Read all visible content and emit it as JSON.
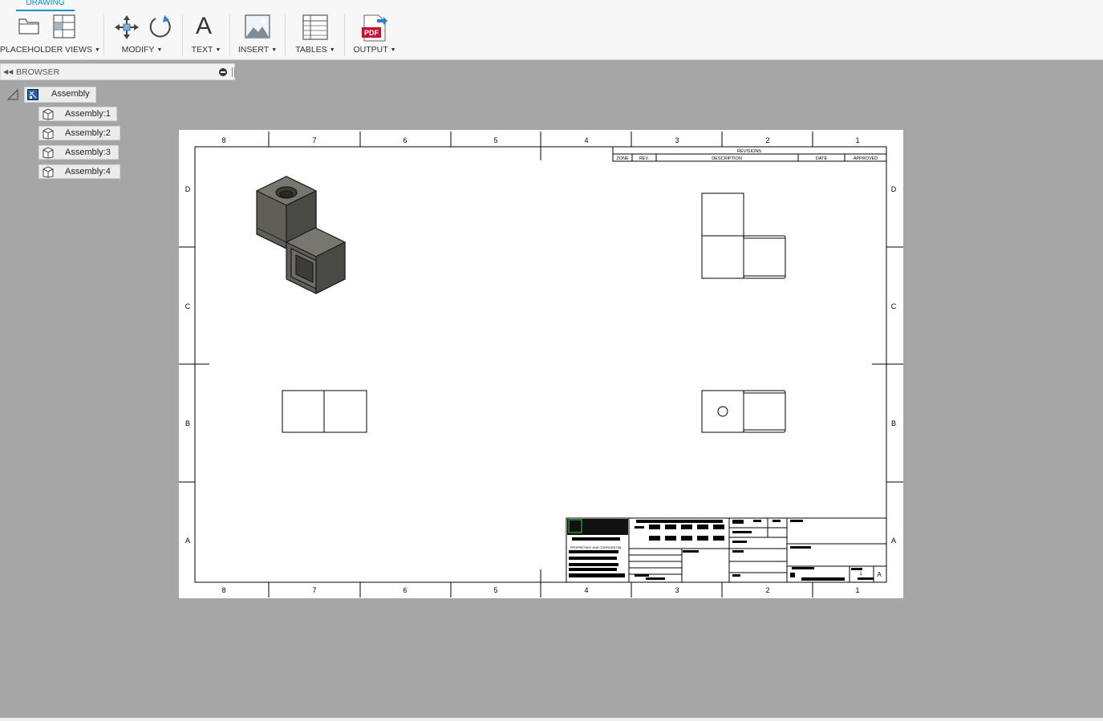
{
  "toolbar": {
    "active_tab": "DRAWING",
    "groups": [
      {
        "label": "PLACEHOLDER VIEWS"
      },
      {
        "label": "MODIFY"
      },
      {
        "label": "TEXT"
      },
      {
        "label": "INSERT"
      },
      {
        "label": "TABLES"
      },
      {
        "label": "OUTPUT"
      }
    ],
    "text_glyph": "A",
    "pdf_text": "PDF"
  },
  "browser": {
    "title": "BROWSER",
    "root": "Assembly",
    "children": [
      "Assembly:1",
      "Assembly:2",
      "Assembly:3",
      "Assembly:4"
    ]
  },
  "sheet": {
    "col_labels": [
      "8",
      "7",
      "6",
      "5",
      "4",
      "3",
      "2",
      "1"
    ],
    "row_labels": [
      "D",
      "C",
      "B",
      "A"
    ],
    "revisions": {
      "title": "REVISIONS",
      "headers": [
        "ZONE",
        "REV.",
        "DESCRIPTION",
        "DATE",
        "APPROVED"
      ]
    },
    "title_block": {
      "proprietary": "PROPRIETARY AND CONFIDENTIAL",
      "sheet_no": "1",
      "size": "A"
    }
  },
  "colors": {
    "accent": "#0a8fd0",
    "canvas": "#a6a6a6",
    "part_dark": "#4a4a44",
    "part_mid": "#5f5e57",
    "part_light": "#78776f"
  }
}
